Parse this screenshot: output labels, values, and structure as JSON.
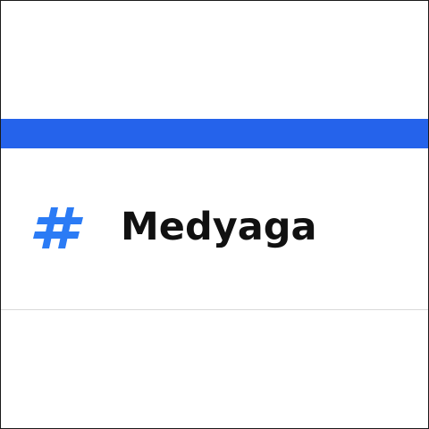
{
  "header": {
    "accent_color": "#2563eb"
  },
  "brand": {
    "name": "Medyaga",
    "icon": "hashtag-icon",
    "icon_color": "#2b7bf5"
  }
}
